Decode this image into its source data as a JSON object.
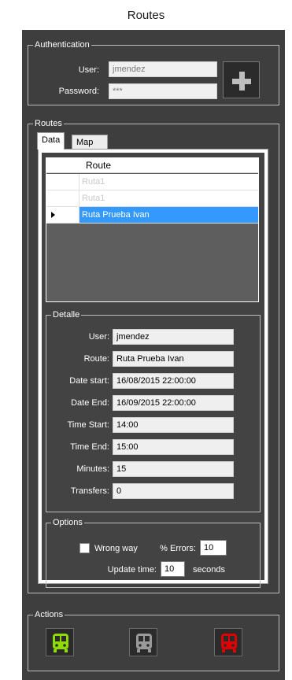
{
  "window": {
    "title": "Routes"
  },
  "authentication": {
    "legend": "Authentication",
    "user_label": "User:",
    "user_value": "jmendez",
    "password_label": "Password:",
    "password_value": "***"
  },
  "routes": {
    "legend": "Routes",
    "tabs": [
      {
        "label": "Data"
      },
      {
        "label": "Map"
      }
    ],
    "grid": {
      "column": "Route",
      "rows": [
        {
          "value": "Ruta1"
        },
        {
          "value": "Ruta1"
        },
        {
          "value": "Ruta Prueba Ivan"
        }
      ]
    },
    "detalle": {
      "legend": "Detalle",
      "fields": [
        {
          "label": "User:",
          "value": "jmendez"
        },
        {
          "label": "Route:",
          "value": "Ruta Prueba Ivan"
        },
        {
          "label": "Date start:",
          "value": "16/08/2015 22:00:00"
        },
        {
          "label": "Date End:",
          "value": "16/09/2015 22:00:00"
        },
        {
          "label": "Time Start:",
          "value": "14:00"
        },
        {
          "label": "Time End:",
          "value": "15:00"
        },
        {
          "label": "Minutes:",
          "value": "15"
        },
        {
          "label": "Transfers:",
          "value": "0"
        }
      ]
    },
    "options": {
      "legend": "Options",
      "wrong_way_label": "Wrong way",
      "errors_label": "% Errors:",
      "errors_value": "10",
      "update_label": "Update time:",
      "update_value": "10",
      "seconds_label": "seconds"
    }
  },
  "actions": {
    "legend": "Actions",
    "buttons": [
      {
        "icon": "bus-icon",
        "color": "#8fdc00"
      },
      {
        "icon": "bus-icon",
        "color": "#9a9a9a"
      },
      {
        "icon": "bus-icon",
        "color": "#e00000"
      }
    ]
  }
}
